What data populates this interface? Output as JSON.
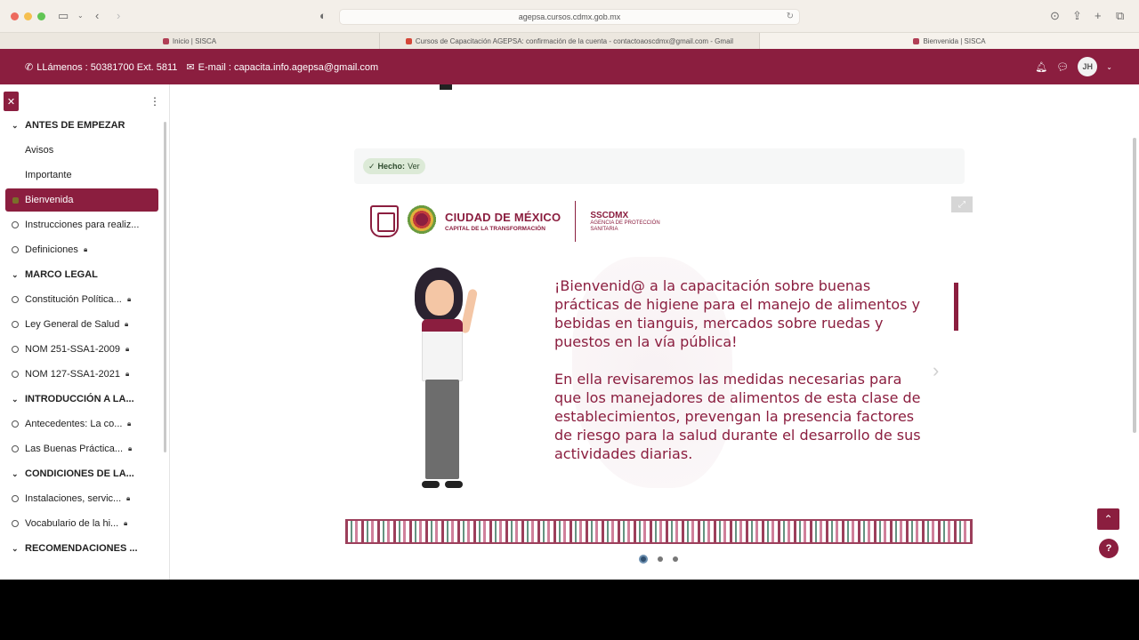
{
  "browser": {
    "url": "agepsa.cursos.cdmx.gob.mx",
    "tabs": [
      {
        "label": "Inicio | SISCA"
      },
      {
        "label": "Cursos de Capacitación AGEPSA: confirmación de la cuenta - contactoaoscdmx@gmail.com - Gmail"
      },
      {
        "label": "Bienvenida | SISCA"
      }
    ]
  },
  "header": {
    "phone": "LLámenos : 50381700 Ext. 5811",
    "email": "E-mail : capacita.info.agepsa@gmail.com",
    "avatar_initials": "JH",
    "color": "#8b1e3f"
  },
  "sidebar": {
    "items": [
      {
        "type": "section",
        "label": "ANTES DE EMPEZAR"
      },
      {
        "type": "page",
        "label": "Avisos"
      },
      {
        "type": "page",
        "label": "Importante"
      },
      {
        "type": "active",
        "label": "Bienvenida"
      },
      {
        "type": "item",
        "label": "Instrucciones para realiz..."
      },
      {
        "type": "item",
        "label": "Definiciones",
        "locked": true
      },
      {
        "type": "section",
        "label": "MARCO LEGAL"
      },
      {
        "type": "item",
        "label": "Constitución Política...",
        "locked": true
      },
      {
        "type": "item",
        "label": "Ley General de Salud",
        "locked": true
      },
      {
        "type": "item",
        "label": "NOM 251-SSA1-2009",
        "locked": true
      },
      {
        "type": "item",
        "label": "NOM 127-SSA1-2021",
        "locked": true
      },
      {
        "type": "section",
        "label": "INTRODUCCIÓN A LA..."
      },
      {
        "type": "item",
        "label": "Antecedentes: La co...",
        "locked": true
      },
      {
        "type": "item",
        "label": "Las Buenas Práctica...",
        "locked": true
      },
      {
        "type": "section",
        "label": "CONDICIONES DE LA..."
      },
      {
        "type": "item",
        "label": "Instalaciones, servic...",
        "locked": true
      },
      {
        "type": "item",
        "label": "Vocabulario de la hi...",
        "locked": true
      },
      {
        "type": "section",
        "label": "RECOMENDACIONES ..."
      }
    ]
  },
  "main": {
    "done_badge": {
      "label": "Hecho:",
      "action": "Ver"
    },
    "slide": {
      "logo_city": "CIUDAD DE MÉXICO",
      "logo_city_sub": "CAPITAL DE LA TRANSFORMACIÓN",
      "logo_agency": "SSCDMX",
      "logo_agency_sub1": "AGENCIA DE PROTECCIÓN",
      "logo_agency_sub2": "SANITARIA",
      "paragraph1": "¡Bienvenid@ a la capacitación sobre buenas prácticas de higiene para el manejo de alimentos y bebidas en tianguis, mercados sobre ruedas y puestos en la vía pública!",
      "paragraph2": "En ella revisaremos las medidas necesarias para que los manejadores de alimentos de esta clase de establecimientos, prevengan la presencia factores de riesgo para la salud durante el desarrollo de sus actividades diarias."
    },
    "pagination": {
      "total": 3,
      "current": 1
    },
    "help_label": "?"
  }
}
